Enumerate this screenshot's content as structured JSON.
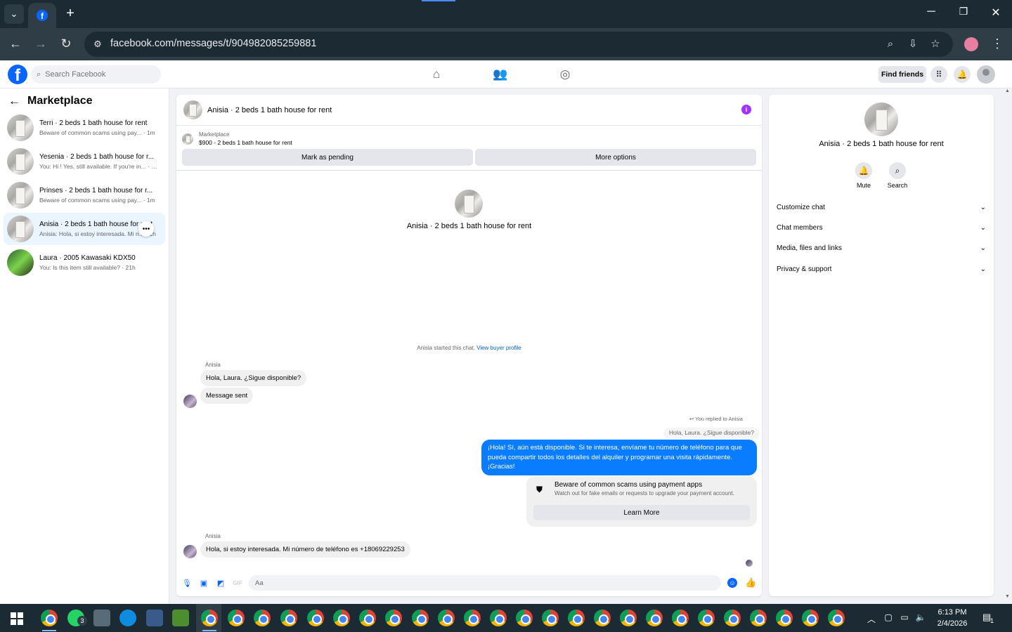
{
  "browser": {
    "url": "facebook.com/messages/t/904982085259881",
    "tab_favicon": "f",
    "window_controls": {
      "minimize": "─",
      "restore": "❐",
      "close": "✕"
    }
  },
  "fb_header": {
    "logo": "f",
    "search_placeholder": "Search Facebook",
    "find_friends": "Find friends"
  },
  "sidebar": {
    "title": "Marketplace",
    "items": [
      {
        "name": "Terri · 2 beds 1 bath house for rent",
        "preview": "Beware of common scams using pay... · 1m"
      },
      {
        "name": "Yesenia · 2 beds 1 bath house for r...",
        "preview": "You: Hi ! Yes, still available. If you're in... · 1m"
      },
      {
        "name": "Prinses · 2 beds 1 bath house for r...",
        "preview": "Beware of common scams using pay... · 1m"
      },
      {
        "name": "Anisia · 2 beds 1 bath house for rent",
        "preview": "Anisia: Hola, si estoy interesada. Mi n... · 1h"
      },
      {
        "name": "Laura · 2005 Kawasaki KDX50",
        "preview": "You: Is this item still available? · 21h"
      }
    ]
  },
  "chat": {
    "title": "Anisia · 2 beds 1 bath house for rent",
    "marketplace_label": "Marketplace",
    "listing": "$900 - 2 beds 1 bath house for rent",
    "mark_pending": "Mark as pending",
    "more_options": "More options",
    "center_name": "Anisia · 2 beds 1 bath house for rent",
    "started_text": "Anisia started this chat.",
    "view_buyer": "View buyer profile",
    "sender1": "Anisia",
    "msg1": "Hola, Laura. ¿Sigue disponible?",
    "msg2": "Message sent",
    "replied_to": "You replied to Anisia",
    "quoted": "Hola, Laura. ¿Sigue disponible?",
    "out_msg": "¡Hola! Sí, aún está disponible. Si te interesa, envíame tu número de teléfono para que pueda compartir todos los detalles del alquiler y programar una visita rápidamente. ¡Gracias!",
    "scam_title": "Beware of common scams using payment apps",
    "scam_desc": "Watch out for fake emails or requests to upgrade your payment account.",
    "learn_more": "Learn More",
    "sender2": "Anisia",
    "msg3": "Hola, si estoy interesada. Mi número de teléfono es +18069229253",
    "composer_placeholder": "Aa"
  },
  "right_panel": {
    "name": "Anisia · 2 beds 1 bath house for rent",
    "mute": "Mute",
    "search": "Search",
    "rows": [
      "Customize chat",
      "Chat members",
      "Media, files and links",
      "Privacy & support"
    ]
  },
  "taskbar": {
    "time": "6:13 PM",
    "date": "2/4/2026",
    "whatsapp_badge": "3",
    "notif_count": "1"
  }
}
